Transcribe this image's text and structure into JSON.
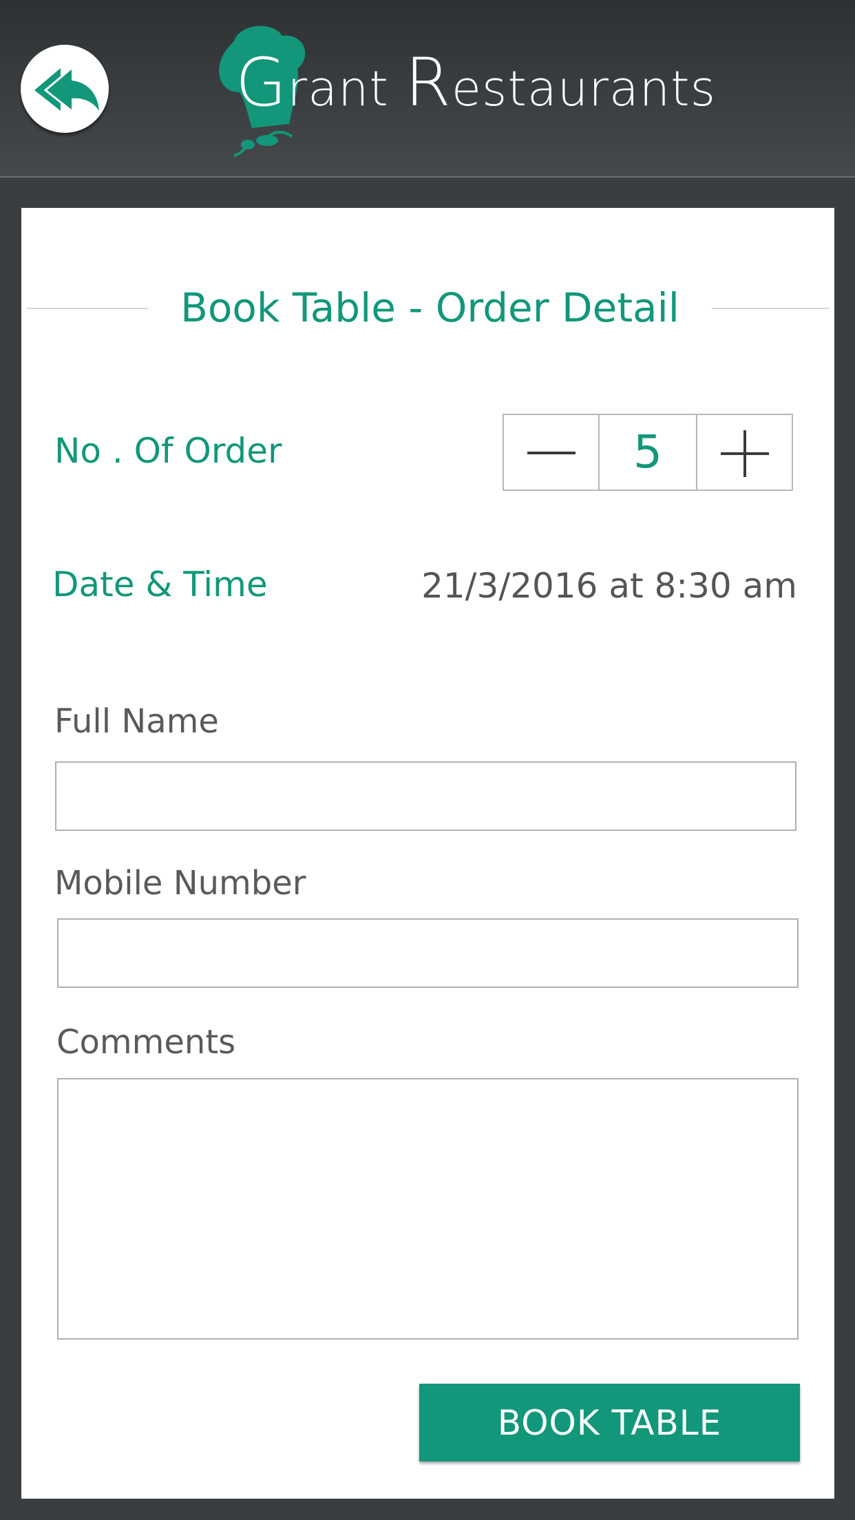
{
  "header": {
    "logo_cap_g": "G",
    "logo_rest_1": "rant ",
    "logo_cap_r": "R",
    "logo_rest_2": "estaurants"
  },
  "form": {
    "title": "Book Table - Order Detail",
    "order_label": "No . Of Order",
    "order_count": "5",
    "datetime_label": "Date & Time",
    "datetime_value": "21/3/2016 at 8:30 am",
    "full_name_label": "Full Name",
    "full_name_value": "",
    "mobile_label": "Mobile Number",
    "mobile_value": "",
    "comments_label": "Comments",
    "comments_value": "",
    "book_button": "BOOK TABLE"
  },
  "icons": {
    "back": "back-arrow-icon",
    "minus": "minus-icon",
    "plus": "plus-icon",
    "logo": "chef-hat-icon"
  },
  "colors": {
    "accent": "#12977a",
    "header_dark": "#2e3133",
    "background": "#3a3e40",
    "card": "#ffffff"
  }
}
